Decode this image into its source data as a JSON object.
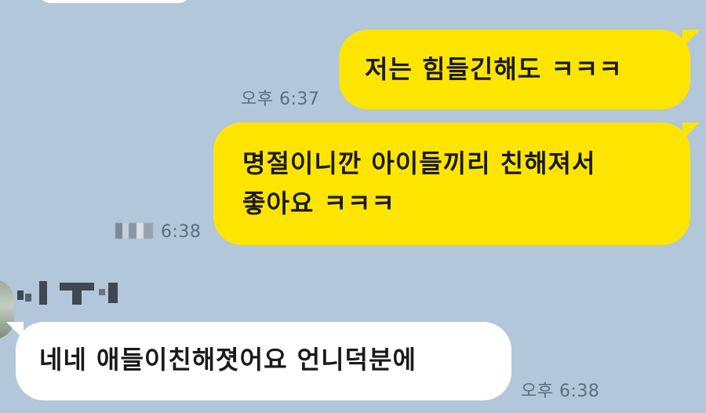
{
  "chat": {
    "messages": [
      {
        "side": "right",
        "text": "저는 힘들긴해도 ㅋㅋㅋ",
        "time": "오후 6:37",
        "bubble_color": "#fee500"
      },
      {
        "side": "right",
        "lines": [
          "명절이니깐 아이들끼리 친해져서",
          "좋아요 ㅋㅋㅋ"
        ],
        "time": "6:38",
        "bubble_color": "#fee500"
      },
      {
        "side": "left",
        "text": "네네 애들이친해졋어요 언니덕분에",
        "time": "오후 6:38",
        "bubble_color": "#ffffff"
      }
    ]
  },
  "colors": {
    "background": "#b2c7d9",
    "my_bubble": "#fee500",
    "other_bubble": "#ffffff",
    "timestamp": "#5c6e7f"
  }
}
